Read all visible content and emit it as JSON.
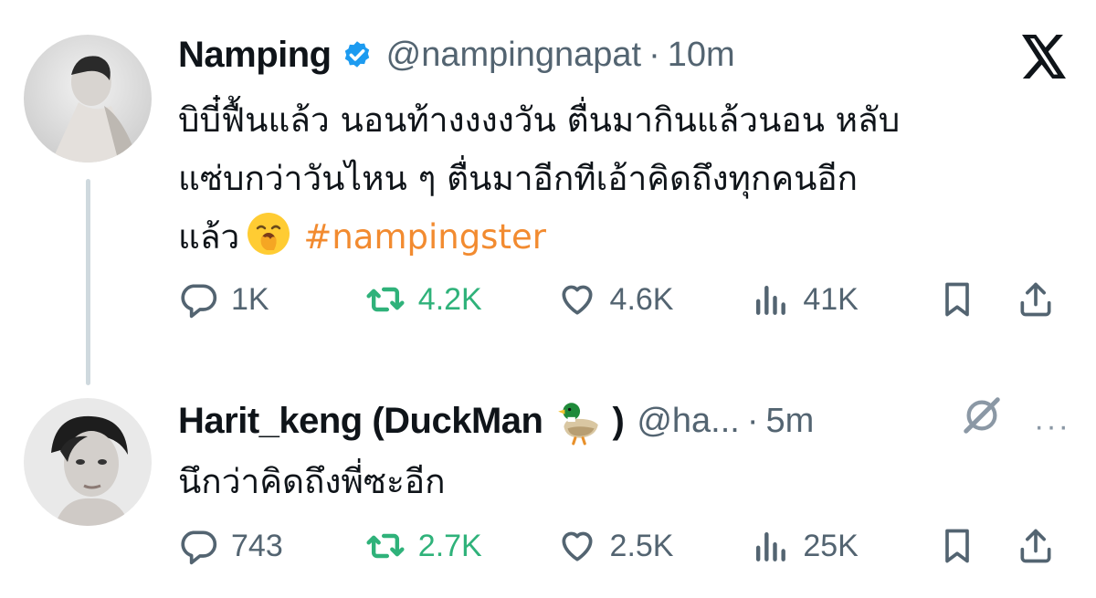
{
  "tweets": [
    {
      "display_name": "Namping",
      "verified": true,
      "handle": "@nampingnapat",
      "separator": "·",
      "time": "10m",
      "text_lines": [
        "บิบี๋ฟื้นแล้ว นอนท้างงงงวัน ตื่นมากินแล้วนอน หลับ",
        "แซ่บกว่าวันไหน ๆ ตื่นมาอีกทีเอ้าคิดถึงทุกคนอีก",
        "แล้ว"
      ],
      "emoji": "yawning-face",
      "hashtag": "#nampingster",
      "stats": {
        "replies": "1K",
        "reposts": "4.2K",
        "likes": "4.6K",
        "views": "41K"
      }
    },
    {
      "display_name": "Harit_keng (DuckMan",
      "name_emoji": "duck",
      "name_close": ")",
      "handle": "@ha...",
      "separator": "·",
      "time": "5m",
      "text_lines": [
        "นึกว่าคิดถึงพี่ซะอีก"
      ],
      "stats": {
        "replies": "743",
        "reposts": "2.7K",
        "likes": "2.5K",
        "views": "25K"
      }
    }
  ],
  "icons": {
    "brand": "x-logo",
    "more": "···"
  },
  "colors": {
    "repost": "#2fb27a",
    "hashtag": "#f28b30",
    "verified": "#1d9bf0",
    "muted": "#536471"
  }
}
